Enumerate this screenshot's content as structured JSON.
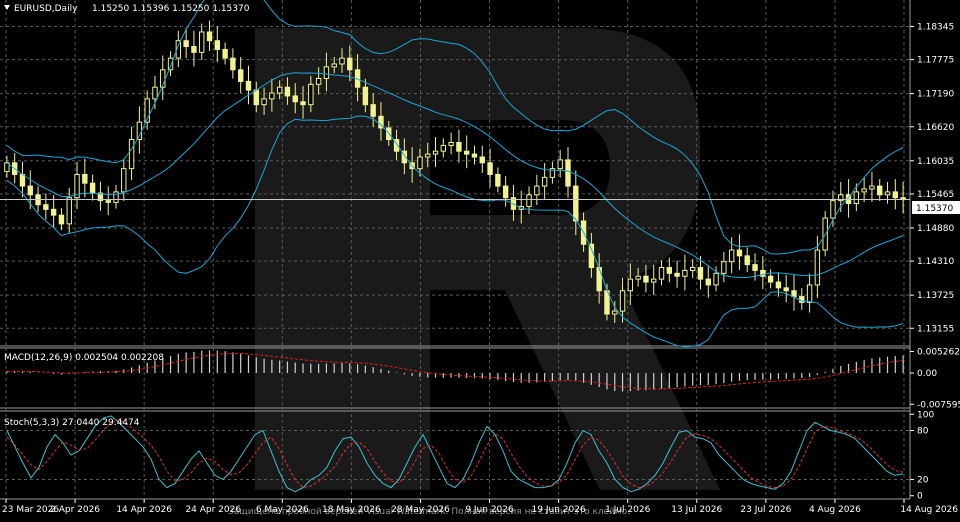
{
  "chart_data": {
    "type": "candlestick",
    "symbol_header": "EURUSD,Daily",
    "ohlc_header": "1.15250 1.15396 1.15250 1.15370",
    "current_price_label": "1.15370",
    "colors": {
      "background": "#000000",
      "grid": "#5a5a5a",
      "candle": "#f2f28e",
      "bollinger": "#1aa7d8",
      "macd_hist": "#d0d0d0",
      "macd_signal": "#e02020",
      "stoch_main": "#3cc0d0",
      "stoch_signal": "#e03030",
      "text": "#ffffff"
    },
    "main_panel": {
      "ylim": [
        1.1285,
        1.188
      ],
      "price_ticks": [
        "1.18345",
        "1.17775",
        "1.17190",
        "1.16620",
        "1.16035",
        "1.15465",
        "1.14880",
        "1.14310",
        "1.13725",
        "1.13155"
      ],
      "price_values": [
        1.18345,
        1.17775,
        1.1719,
        1.1662,
        1.16035,
        1.15465,
        1.1488,
        1.1431,
        1.13725,
        1.13155
      ],
      "current_price": 1.1537,
      "closes": [
        1.16,
        1.158,
        1.156,
        1.1545,
        1.1528,
        1.152,
        1.151,
        1.1495,
        1.154,
        1.158,
        1.1565,
        1.1548,
        1.1535,
        1.1532,
        1.155,
        1.159,
        1.164,
        1.167,
        1.171,
        1.173,
        1.176,
        1.178,
        1.181,
        1.18,
        1.179,
        1.1825,
        1.181,
        1.1795,
        1.178,
        1.176,
        1.174,
        1.1725,
        1.17,
        1.171,
        1.172,
        1.173,
        1.1715,
        1.1705,
        1.17,
        1.1735,
        1.1745,
        1.1765,
        1.177,
        1.178,
        1.176,
        1.173,
        1.17,
        1.168,
        1.166,
        1.164,
        1.162,
        1.16,
        1.159,
        1.161,
        1.1615,
        1.162,
        1.163,
        1.1635,
        1.162,
        1.1615,
        1.161,
        1.16,
        1.158,
        1.156,
        1.154,
        1.152,
        1.1525,
        1.1545,
        1.156,
        1.1575,
        1.159,
        1.1605,
        1.156,
        1.15,
        1.146,
        1.142,
        1.138,
        1.134,
        1.1345,
        1.138,
        1.14,
        1.1405,
        1.1395,
        1.14,
        1.142,
        1.141,
        1.1405,
        1.1415,
        1.142,
        1.14,
        1.139,
        1.141,
        1.143,
        1.145,
        1.144,
        1.1425,
        1.1415,
        1.1405,
        1.1395,
        1.1385,
        1.138,
        1.137,
        1.136,
        1.139,
        1.145,
        1.1505,
        1.1535,
        1.1545,
        1.153,
        1.155,
        1.1555,
        1.156,
        1.1545,
        1.155,
        1.154,
        1.1537
      ]
    },
    "macd_panel": {
      "label": "MACD(12,26,9) 0.002504 0.002208",
      "ylim": [
        -0.0085,
        0.0061
      ],
      "ticks": [
        "0.005262",
        "0.00",
        "-0.007595"
      ],
      "tick_values": [
        0.005262,
        0.0,
        -0.007595
      ],
      "hist_start": -0.0022,
      "hist_end": 0.0025
    },
    "stoch_panel": {
      "label": "Stoch(5,3,3) 27.0440 29.4474",
      "ylim": [
        -4,
        104
      ],
      "ticks": [
        "100",
        "80",
        "20",
        "0"
      ],
      "tick_values": [
        100,
        80,
        20,
        0
      ],
      "main": [
        80,
        60,
        40,
        22,
        35,
        60,
        75,
        65,
        50,
        55,
        70,
        85,
        95,
        98,
        90,
        80,
        70,
        60,
        45,
        20,
        10,
        15,
        30,
        45,
        55,
        40,
        25,
        20,
        30,
        45,
        60,
        75,
        80,
        55,
        30,
        10,
        5,
        10,
        20,
        25,
        35,
        55,
        70,
        72,
        60,
        40,
        25,
        15,
        10,
        20,
        40,
        60,
        75,
        55,
        35,
        15,
        10,
        20,
        40,
        65,
        85,
        75,
        55,
        30,
        20,
        15,
        10,
        10,
        12,
        20,
        40,
        65,
        80,
        75,
        55,
        40,
        20,
        10,
        5,
        8,
        15,
        25,
        40,
        60,
        78,
        80,
        72,
        70,
        65,
        50,
        40,
        30,
        20,
        15,
        12,
        10,
        8,
        15,
        30,
        55,
        80,
        90,
        85,
        80,
        78,
        75,
        70,
        60,
        50,
        40,
        30,
        25,
        27
      ],
      "signal": [
        72,
        62,
        50,
        38,
        32,
        42,
        55,
        66,
        62,
        56,
        58,
        68,
        80,
        90,
        93,
        88,
        80,
        72,
        62,
        48,
        30,
        18,
        20,
        28,
        40,
        46,
        42,
        32,
        26,
        28,
        38,
        52,
        65,
        72,
        58,
        38,
        20,
        10,
        12,
        18,
        26,
        36,
        52,
        64,
        66,
        58,
        42,
        28,
        18,
        16,
        26,
        42,
        58,
        62,
        52,
        34,
        20,
        16,
        24,
        42,
        62,
        76,
        70,
        52,
        36,
        24,
        16,
        12,
        12,
        16,
        26,
        44,
        62,
        72,
        68,
        56,
        40,
        24,
        14,
        10,
        12,
        18,
        28,
        42,
        58,
        72,
        76,
        74,
        70,
        62,
        52,
        42,
        32,
        22,
        16,
        12,
        10,
        12,
        20,
        36,
        58,
        78,
        85,
        84,
        80,
        77,
        73,
        67,
        58,
        48,
        38,
        31,
        29
      ]
    },
    "date_labels": [
      "23 Mar 2026",
      "2 Apr 2026",
      "14 Apr 2026",
      "24 Apr 2026",
      "6 May 2026",
      "18 May 2026",
      "28 May 2026",
      "9 Jun 2026",
      "19 Jun 2026",
      "1 Jul 2026",
      "13 Jul 2026",
      "23 Jul 2026",
      "4 Aug 2026",
      "14 Aug 2026"
    ],
    "watermark_text": "Защищено пробной версией Visual Watermark. Полная версия не ставит это клеймо."
  }
}
